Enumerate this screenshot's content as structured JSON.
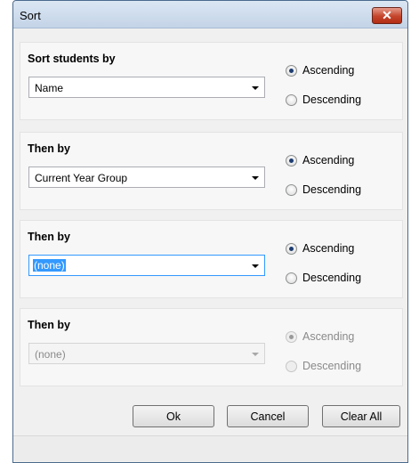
{
  "dialog": {
    "title": "Sort",
    "close_symbol": "✕"
  },
  "groups": [
    {
      "label": "Sort students by",
      "value": "Name",
      "ascending": "Ascending",
      "descending": "Descending"
    },
    {
      "label": "Then by",
      "value": "Current Year Group",
      "ascending": "Ascending",
      "descending": "Descending"
    },
    {
      "label": "Then by",
      "value": "(none)",
      "ascending": "Ascending",
      "descending": "Descending"
    },
    {
      "label": "Then by",
      "value": "(none)",
      "ascending": "Ascending",
      "descending": "Descending"
    }
  ],
  "buttons": {
    "ok": "Ok",
    "cancel": "Cancel",
    "clear_all": "Clear All"
  },
  "colors": {
    "focus": "#3399ff",
    "close": "#c4442b"
  }
}
